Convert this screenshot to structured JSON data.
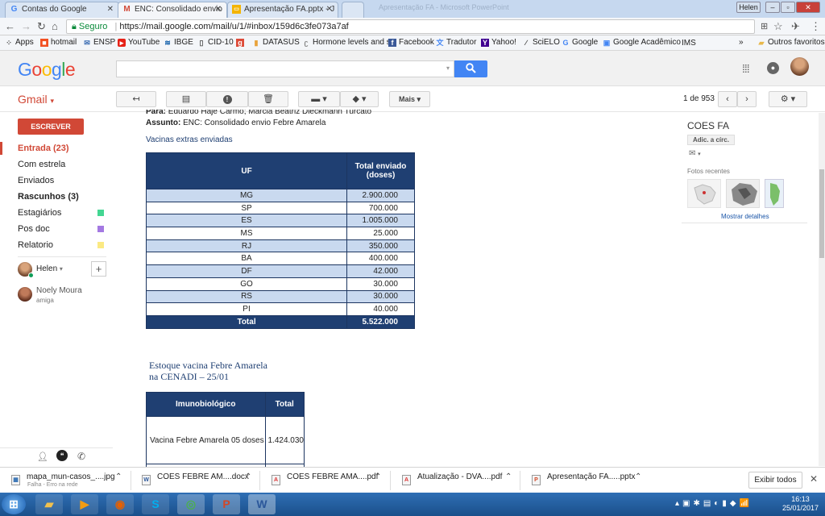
{
  "browser": {
    "tabs": [
      {
        "label": "Contas do Google",
        "icon": "google-g-icon"
      },
      {
        "label": "ENC: Consolidado envio",
        "icon": "gmail-icon"
      },
      {
        "label": "Apresentação FA.pptx - J",
        "icon": "slides-icon"
      },
      {
        "label": "",
        "icon": "blank-tab-icon"
      }
    ],
    "background_window_title": "Apresentação FA - Microsoft PowerPoint",
    "user_badge": "Helen",
    "secure_label": "Seguro",
    "url": "https://mail.google.com/mail/u/1/#inbox/159d6c3fe073a7af",
    "bookmarks": [
      "Apps",
      "hotmail",
      "ENSP",
      "YouTube",
      "IBGE",
      "CID-10",
      "DATASUS",
      "Hormone levels and s",
      "Facebook",
      "Tradutor",
      "Yahoo!",
      "SciELO",
      "Google",
      "Google Acadêmico",
      "IMS"
    ],
    "bookmarks_more": "»",
    "other_bookmarks": "Outros favoritos"
  },
  "google": {
    "logo": [
      "G",
      "o",
      "o",
      "g",
      "l",
      "e"
    ],
    "logo_colors": [
      "#4285f4",
      "#ea4335",
      "#fbbc05",
      "#4285f4",
      "#34a853",
      "#ea4335"
    ]
  },
  "gmail": {
    "brand": "Gmail",
    "toolbar": {
      "more": "Mais",
      "pager": "1 de 953"
    },
    "compose": "ESCREVER",
    "nav": [
      {
        "label": "Entrada (23)",
        "style": "red"
      },
      {
        "label": "Com estrela",
        "style": ""
      },
      {
        "label": "Enviados",
        "style": ""
      },
      {
        "label": "Rascunhos (3)",
        "style": "bold"
      },
      {
        "label": "Estagiários",
        "style": "",
        "color": "#43d692"
      },
      {
        "label": "Pos doc",
        "style": "",
        "color": "#a479e2"
      },
      {
        "label": "Relatorio",
        "style": "",
        "color": "#fbe983"
      }
    ],
    "chat_user": "Helen",
    "contact": {
      "name": "Noely Moura",
      "status": "amiga"
    }
  },
  "email": {
    "to_label": "Para:",
    "to_value": "Eduardo Haje Carmo; Marcia Beatriz Dieckmann Turcato",
    "subject_label": "Assunto:",
    "subject_value": "ENC: Consolidado envio Febre Amarela",
    "table1_title": "Vacinas extras enviadas",
    "table1_headers": [
      "UF",
      "Total enviado (doses)"
    ],
    "table1_rows": [
      [
        "MG",
        "2.900.000"
      ],
      [
        "SP",
        "700.000"
      ],
      [
        "ES",
        "1.005.000"
      ],
      [
        "MS",
        "25.000"
      ],
      [
        "RJ",
        "350.000"
      ],
      [
        "BA",
        "400.000"
      ],
      [
        "DF",
        "42.000"
      ],
      [
        "GO",
        "30.000"
      ],
      [
        "RS",
        "30.000"
      ],
      [
        "PI",
        "40.000"
      ]
    ],
    "table1_total": [
      "Total",
      "5.522.000"
    ],
    "table2_title_line1": "Estoque vacina Febre Amarela",
    "table2_title_line2": "na CENADI – 25/01",
    "table2_headers": [
      "Imunobiológico",
      "Total"
    ],
    "table2_rows": [
      [
        "Vacina Febre Amarela 05 doses",
        "1.424.030"
      ]
    ]
  },
  "right_panel": {
    "contact_name": "COES FA",
    "add_circle": "Adic. a círc.",
    "recent_photos": "Fotos recentes",
    "show_details": "Mostrar detalhes"
  },
  "downloads": [
    {
      "name": "mapa_mun-casos_....jpg",
      "sub": "Falha - Erro na rede",
      "type": "jpg"
    },
    {
      "name": "COES FEBRE AM....docx",
      "sub": "",
      "type": "docx"
    },
    {
      "name": "COES FEBRE AMA....pdf",
      "sub": "",
      "type": "pdf"
    },
    {
      "name": "Atualização - DVA....pdf",
      "sub": "",
      "type": "pdf"
    },
    {
      "name": "Apresentação FA.....pptx",
      "sub": "",
      "type": "pptx"
    }
  ],
  "downloads_show_all": "Exibir todos",
  "taskbar": {
    "time": "16:13",
    "date": "25/01/2017",
    "apps": [
      "windows-start-icon",
      "explorer-icon",
      "media-player-icon",
      "firefox-icon",
      "skype-icon",
      "chrome-icon",
      "powerpoint-icon",
      "word-icon"
    ]
  }
}
